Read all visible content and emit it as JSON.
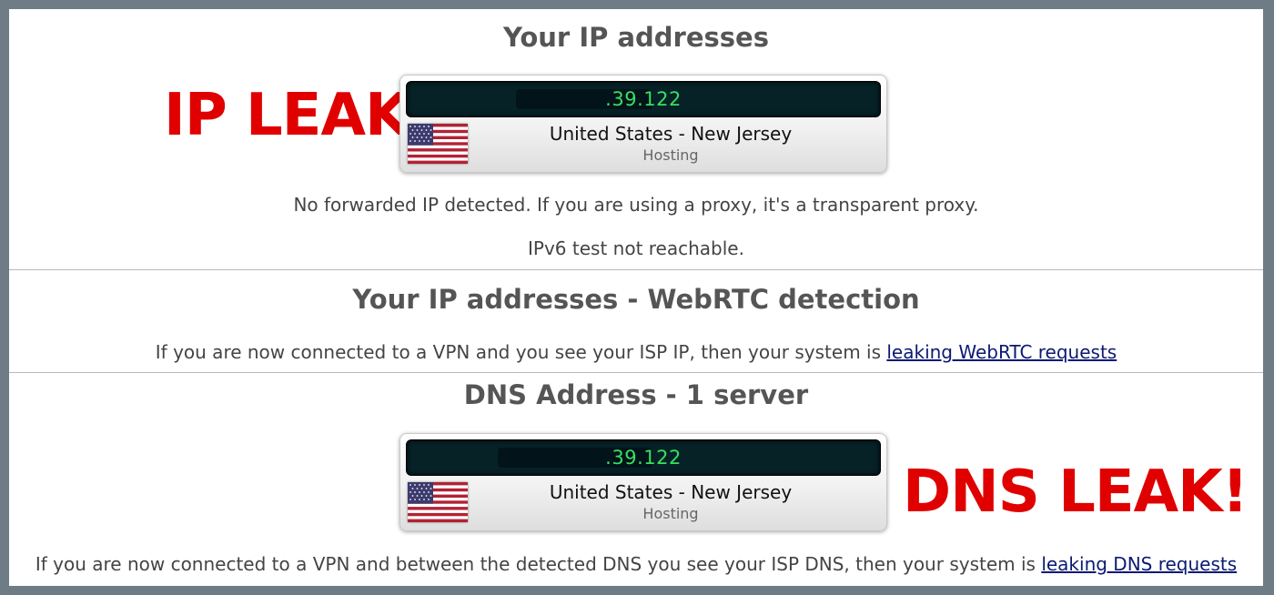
{
  "ip_section": {
    "title": "Your IP addresses",
    "ip_value": ".39.122",
    "location": "United States - New Jersey",
    "isp_type": "Hosting",
    "forwarded_note": "No forwarded IP detected. If you are using a proxy, it's a transparent proxy.",
    "ipv6_note": "IPv6 test not reachable."
  },
  "leak_labels": {
    "ip_leak": "IP LEAK!",
    "dns_leak": "DNS LEAK!",
    "color": "#e00000"
  },
  "webrtc_section": {
    "title": "Your IP addresses - WebRTC detection",
    "text": "If you are now connected to a VPN and you see your ISP IP, then your system is ",
    "link": "leaking WebRTC requests"
  },
  "dns_section": {
    "title": "DNS Address - 1 server",
    "ip_value": ".39.122",
    "location": "United States - New Jersey",
    "isp_type": "Hosting",
    "text": "If you are now connected to a VPN and between the detected DNS you see your ISP DNS, then your system is ",
    "link": "leaking DNS requests"
  },
  "icons": {
    "flag": "us-flag-icon"
  },
  "colors": {
    "ip_text": "#37e060",
    "ip_bar": "#062227",
    "link": "#0b1a73",
    "frame": "#6e7c86"
  }
}
